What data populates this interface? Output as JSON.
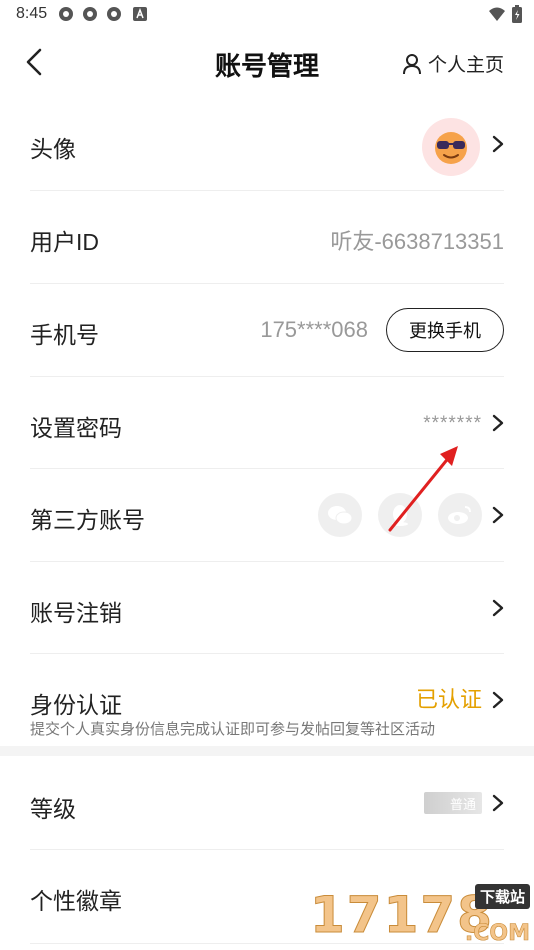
{
  "status_bar": {
    "time": "8:45"
  },
  "header": {
    "title": "账号管理",
    "profile_link": "个人主页"
  },
  "rows": {
    "avatar": {
      "label": "头像"
    },
    "user_id": {
      "label": "用户ID",
      "value": "听友-6638713351"
    },
    "phone": {
      "label": "手机号",
      "value": "175****068",
      "button": "更换手机"
    },
    "password": {
      "label": "设置密码",
      "value": "*******"
    },
    "third_party": {
      "label": "第三方账号",
      "accounts": [
        "wechat-icon",
        "qq-icon",
        "weibo-icon"
      ]
    },
    "cancel_account": {
      "label": "账号注销"
    },
    "identity": {
      "label": "身份认证",
      "status": "已认证",
      "description": "提交个人真实身份信息完成认证即可参与发帖回复等社区活动"
    },
    "level": {
      "label": "等级",
      "badge": "普通"
    },
    "medal": {
      "label": "个性徽章"
    }
  },
  "watermark": {
    "number": "17178",
    "tag": "下载站",
    "suffix": ".COM"
  },
  "colors": {
    "verified": "#e4a000",
    "annotation_arrow": "#e02020"
  }
}
